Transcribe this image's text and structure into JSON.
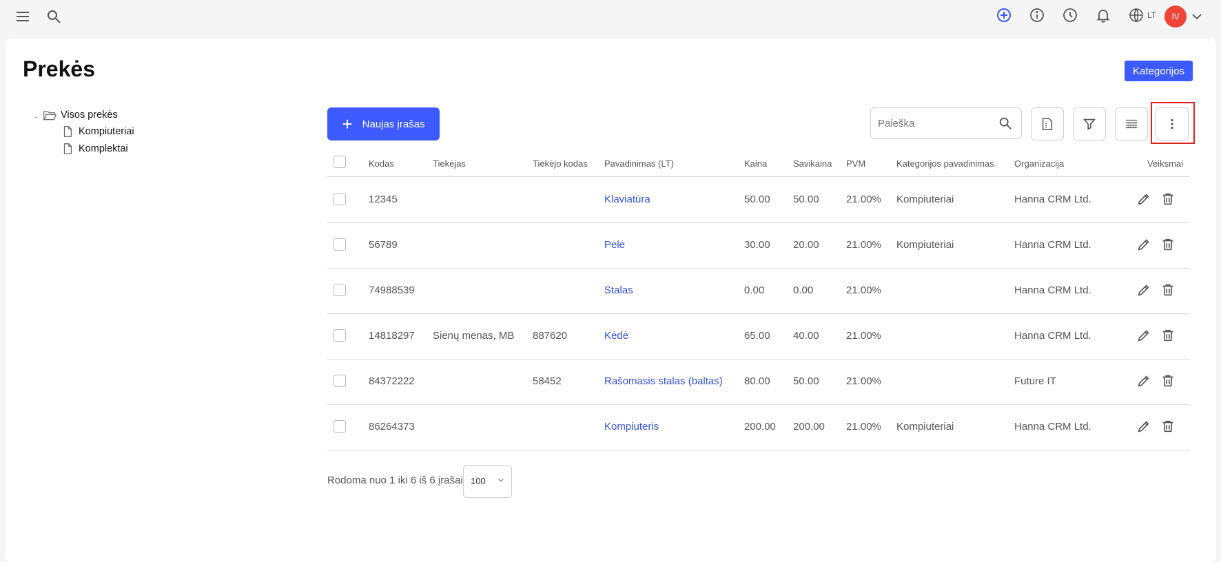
{
  "topbar": {
    "language": "LT",
    "user_initials": "IV",
    "avatar_color": "#f04438"
  },
  "page": {
    "title": "Prekės",
    "categories_button": "Kategorijos",
    "accent_color": "#3d5afe"
  },
  "tree": {
    "root": "Visos prekės",
    "children": [
      "Kompiuteriai",
      "Komplektai"
    ]
  },
  "toolbar": {
    "new_button": "Naujas įrašas",
    "search_placeholder": "Paieška"
  },
  "table": {
    "columns": [
      "Kodas",
      "Tiekėjas",
      "Tiekėjo kodas",
      "Pavadinimas (LT)",
      "Kaina",
      "Savikaina",
      "PVM",
      "Kategorijos pavadinimas",
      "Organizacija",
      "Veiksmai"
    ],
    "rows": [
      {
        "kodas": "12345",
        "tiekejas": "",
        "tiekejo_kodas": "",
        "pavadinimas": "Klaviatūra",
        "kaina": "50.00",
        "savikaina": "50.00",
        "pvm": "21.00%",
        "kategorija": "Kompiuteriai",
        "organizacija": "Hanna CRM Ltd."
      },
      {
        "kodas": "56789",
        "tiekejas": "",
        "tiekejo_kodas": "",
        "pavadinimas": "Pelė",
        "kaina": "30.00",
        "savikaina": "20.00",
        "pvm": "21.00%",
        "kategorija": "Kompiuteriai",
        "organizacija": "Hanna CRM Ltd."
      },
      {
        "kodas": "74988539",
        "tiekejas": "",
        "tiekejo_kodas": "",
        "pavadinimas": "Stalas",
        "kaina": "0.00",
        "savikaina": "0.00",
        "pvm": "21.00%",
        "kategorija": "",
        "organizacija": "Hanna CRM Ltd."
      },
      {
        "kodas": "14818297",
        "tiekejas": "Sienų menas, MB",
        "tiekejo_kodas": "887620",
        "pavadinimas": "Kėdė",
        "kaina": "65.00",
        "savikaina": "40.00",
        "pvm": "21.00%",
        "kategorija": "",
        "organizacija": "Hanna CRM Ltd."
      },
      {
        "kodas": "84372222",
        "tiekejas": "",
        "tiekejo_kodas": "58452",
        "pavadinimas": "Rašomasis stalas (baltas)",
        "kaina": "80.00",
        "savikaina": "50.00",
        "pvm": "21.00%",
        "kategorija": "",
        "organizacija": "Future IT"
      },
      {
        "kodas": "86264373",
        "tiekejas": "",
        "tiekejo_kodas": "",
        "pavadinimas": "Kompiuteris",
        "kaina": "200.00",
        "savikaina": "200.00",
        "pvm": "21.00%",
        "kategorija": "Kompiuteriai",
        "organizacija": "Hanna CRM Ltd."
      }
    ]
  },
  "footer": {
    "summary": "Rodoma nuo 1 iki 6 iš 6 įrašai",
    "page_size": "100"
  }
}
